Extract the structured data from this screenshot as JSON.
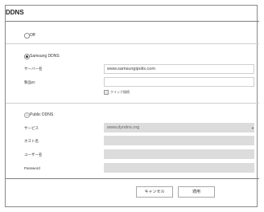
{
  "title": "DDNS",
  "off": {
    "label": "Off"
  },
  "samsung": {
    "label": "Samsung DDNS",
    "server_label": "サーバー名",
    "server_value": "www.samsungipolis.com",
    "product_id_label": "製品ID",
    "product_id_value": "",
    "quick_connect_label": "クイック接続"
  },
  "public": {
    "label": "Public DDNS",
    "service_label": "サービス",
    "service_value": "www.dyndns.org",
    "host_label": "ホスト名",
    "username_label": "ユーザー名",
    "password_label": "Password"
  },
  "buttons": {
    "cancel": "キャンセル",
    "apply": "適用"
  }
}
